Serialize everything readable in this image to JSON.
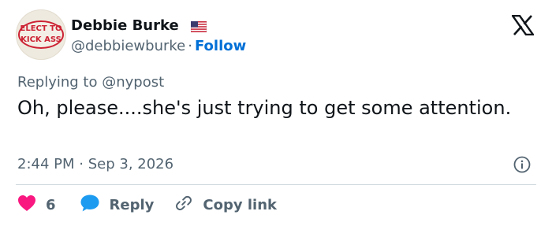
{
  "author": {
    "avatar_text_line1": "ELECT TO",
    "avatar_text_line2": "KICK ASS",
    "display_name": "Debbie Burke",
    "flag_icon": "us-flag-icon",
    "handle": "@debbiewburke",
    "separator": "·",
    "follow_label": "Follow"
  },
  "brand": {
    "icon": "x-logo-icon"
  },
  "reply_context": {
    "prefix": "Replying to",
    "mention": "@nypost"
  },
  "tweet": {
    "text": "Oh, please....she's just trying to get some attention.",
    "time": "2:44 PM",
    "separator": "·",
    "date": "Sep 3, 2026"
  },
  "actions": {
    "like_count": "6",
    "reply_label": "Reply",
    "copy_link_label": "Copy link"
  },
  "colors": {
    "like": "#f91880",
    "reply": "#1d9bf0",
    "follow": "#006fd6",
    "muted": "#536471",
    "text": "#0f1419"
  }
}
